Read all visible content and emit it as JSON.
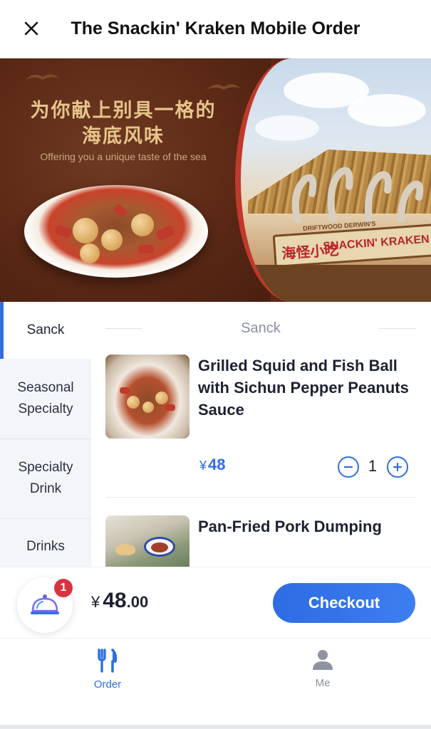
{
  "header": {
    "title": "The Snackin' Kraken Mobile Order"
  },
  "banner": {
    "headline_cn_line1": "为你献上别具一格的",
    "headline_cn_line2": "海底风味",
    "tagline": "Offering you a unique taste of the sea",
    "sign_cn": "海怪小吃",
    "sign_en": "SNACKIN' KRAKEN",
    "sign_top": "DRIFTWOOD DERWIN'S"
  },
  "sidebar": {
    "items": [
      {
        "label": "Sanck"
      },
      {
        "label": "Seasonal Specialty"
      },
      {
        "label": "Specialty Drink"
      },
      {
        "label": "Drinks"
      }
    ]
  },
  "menu": {
    "section_title": "Sanck",
    "items": [
      {
        "name": "Grilled Squid and Fish Ball with Sichun Pepper Peanuts Sauce",
        "currency": "¥",
        "price": "48",
        "quantity": "1"
      },
      {
        "name": "Pan-Fried Pork Dumping"
      }
    ]
  },
  "cart": {
    "badge_count": "1",
    "currency": "¥",
    "total_int": "48",
    "total_dec": ".00",
    "checkout_label": "Checkout"
  },
  "tabbar": {
    "tabs": [
      {
        "label": "Order",
        "icon": "utensils-icon",
        "active": true
      },
      {
        "label": "Me",
        "icon": "person-icon",
        "active": false
      }
    ]
  },
  "colors": {
    "accent": "#2f6fe0",
    "badge": "#d9333f",
    "banner_brown": "#5b2a17",
    "banner_gold": "#e6c48a"
  }
}
